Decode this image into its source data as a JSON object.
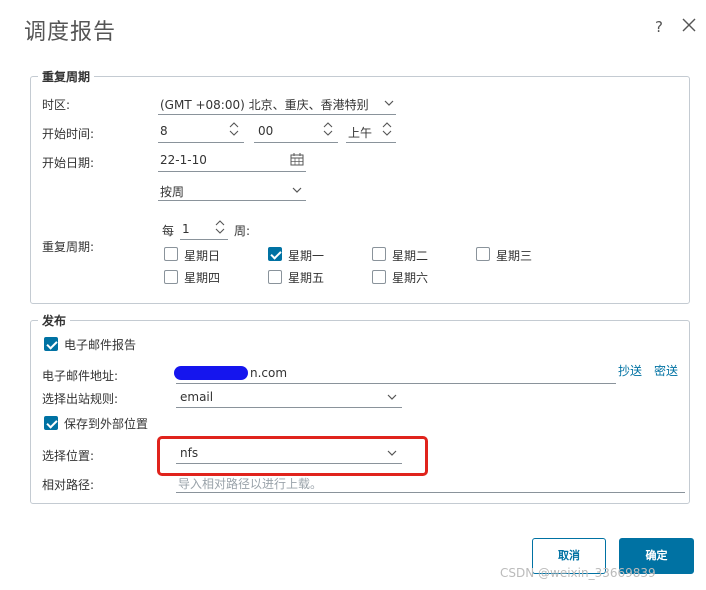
{
  "dialog": {
    "title": "调度报告",
    "help": "?",
    "close_icon": "close-icon"
  },
  "recurrence": {
    "legend": "重复周期",
    "timezone_label": "时区:",
    "timezone_value": "(GMT +08:00) 北京、重庆、香港特别",
    "start_time_label": "开始时间:",
    "start_hour": "8",
    "start_minute": "00",
    "start_ampm": "上午",
    "start_date_label": "开始日期:",
    "start_date_value": "22-1-10",
    "frequency_value": "按周",
    "repeat_label": "重复周期:",
    "every_prefix": "每",
    "every_value": "1",
    "every_suffix": "周:",
    "days": [
      {
        "label": "星期日",
        "checked": false
      },
      {
        "label": "星期一",
        "checked": true
      },
      {
        "label": "星期二",
        "checked": false
      },
      {
        "label": "星期三",
        "checked": false
      },
      {
        "label": "星期四",
        "checked": false
      },
      {
        "label": "星期五",
        "checked": false
      },
      {
        "label": "星期六",
        "checked": false
      }
    ]
  },
  "publish": {
    "legend": "发布",
    "email_report_label": "电子邮件报告",
    "email_report_checked": true,
    "email_address_label": "电子邮件地址:",
    "email_address_value": "n.com",
    "cc_link": "抄送",
    "bcc_link": "密送",
    "outbound_rule_label": "选择出站规则:",
    "outbound_rule_value": "email",
    "save_external_label": "保存到外部位置",
    "save_external_checked": true,
    "location_label": "选择位置:",
    "location_value": "nfs",
    "relative_path_label": "相对路径:",
    "relative_path_placeholder": "导入相对路径以进行上载。"
  },
  "footer": {
    "cancel_label": "取消",
    "ok_label": "确定"
  },
  "watermark": "CSDN @weixin_33669839",
  "colors": {
    "accent": "#0072a3",
    "highlight_box": "#e0231c"
  }
}
